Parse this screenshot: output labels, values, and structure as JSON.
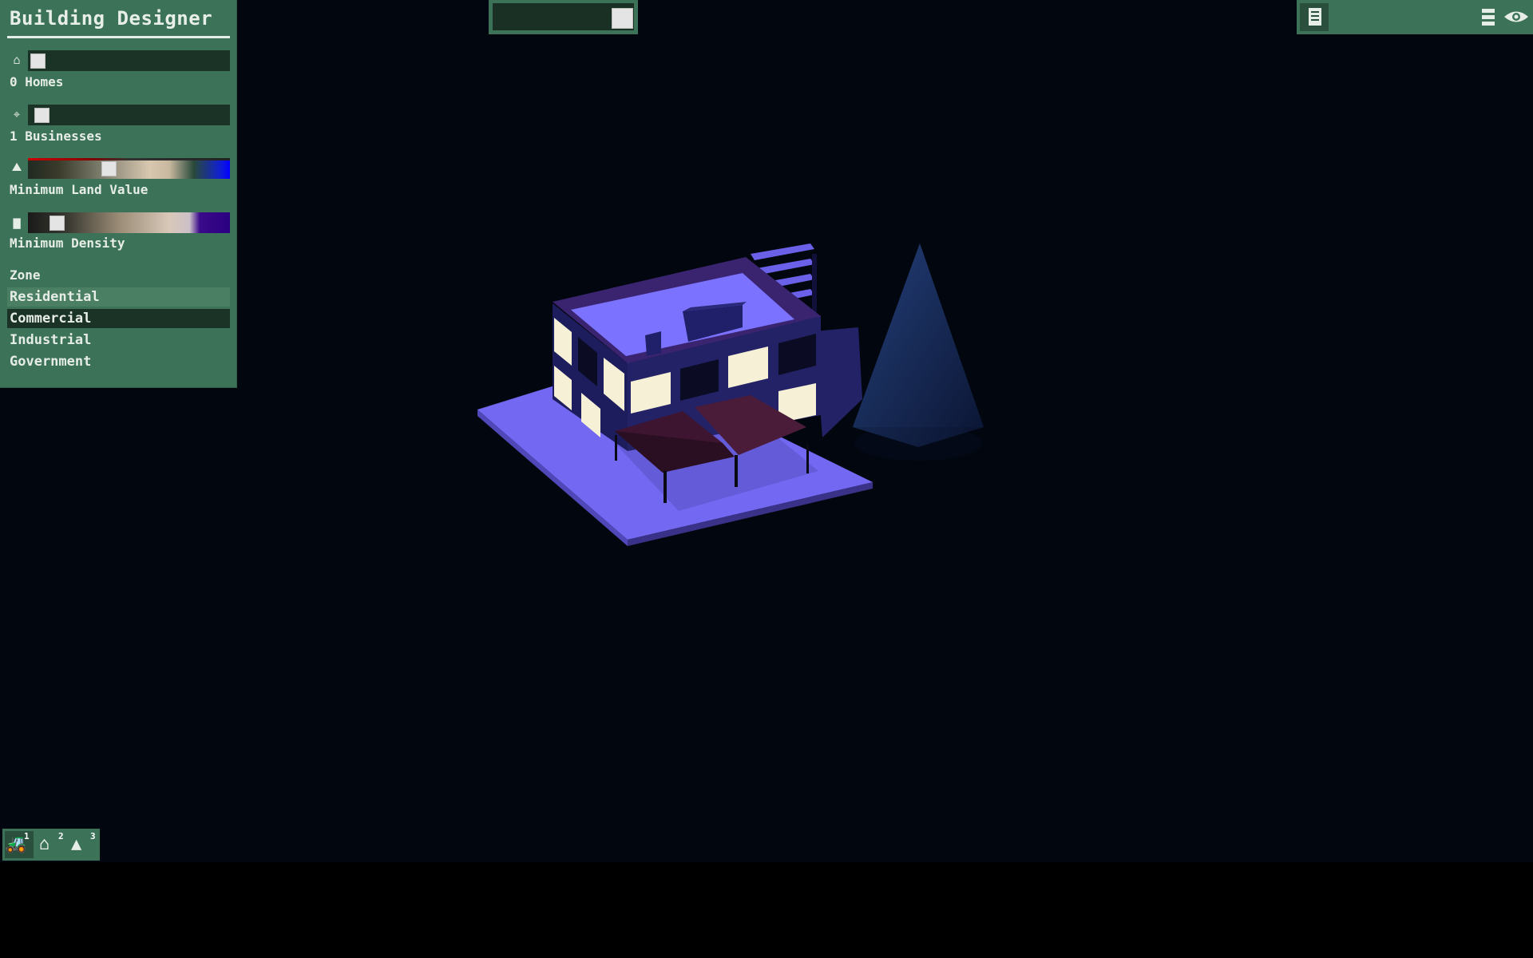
{
  "designer": {
    "title": "Building Designer",
    "homes_label": "0 Homes",
    "businesses_label": "1 Businesses",
    "land_value_label": "Minimum Land Value",
    "density_label": "Minimum Density",
    "homes_value": 0.02,
    "businesses_value": 0.04,
    "land_value": 0.4,
    "density_value": 0.12,
    "zone_heading": "Zone",
    "zones": [
      "Residential",
      "Commercial",
      "Industrial",
      "Government"
    ],
    "selected_zone": "Commercial"
  },
  "top_center": {
    "slider_value": 1.0
  },
  "top_right": {
    "icons": [
      "document-icon",
      "menu-icon",
      "eye-icon"
    ]
  },
  "toolbar": {
    "tools": [
      {
        "icon": "bulldozer-icon",
        "hotkey": "1"
      },
      {
        "icon": "house-icon",
        "hotkey": "2"
      },
      {
        "icon": "tree-icon",
        "hotkey": "3"
      }
    ]
  },
  "colors": {
    "panel": "#3c7358",
    "panel_dark": "#1b3326",
    "sky": "#02070f",
    "lot": "#7268f2",
    "building_wall": "#1d1c5c",
    "window_lit": "#f5f0d6",
    "awning": "#4a1c3a",
    "tree": "#1a2c62"
  }
}
